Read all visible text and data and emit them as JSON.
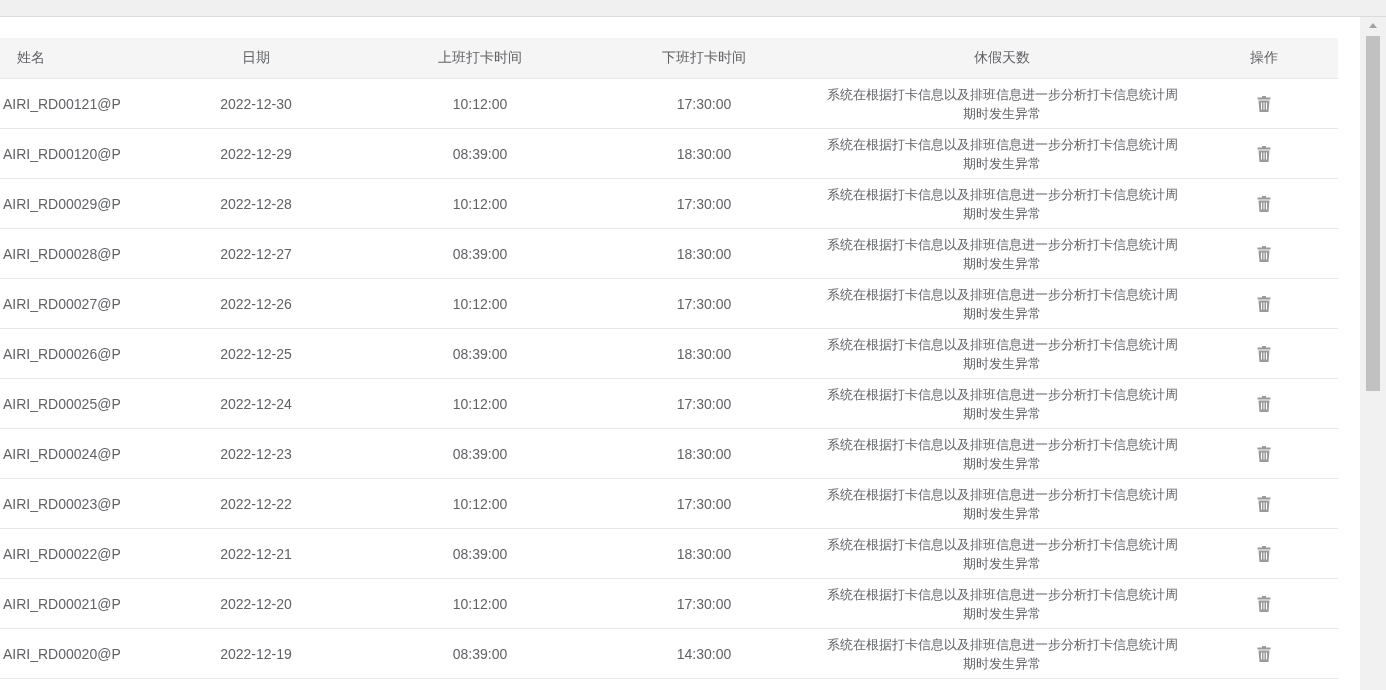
{
  "table": {
    "columns": [
      "姓名",
      "日期",
      "上班打卡时间",
      "下班打卡时间",
      "休假天数",
      "操作"
    ],
    "rows": [
      {
        "name": "AIRI_RD00121@P",
        "date": "2022-12-30",
        "clock_in": "10:12:00",
        "clock_out": "17:30:00",
        "leave_days": "系统在根据打卡信息以及排班信息进一步分析打卡信息统计周期时发生异常"
      },
      {
        "name": "AIRI_RD00120@P",
        "date": "2022-12-29",
        "clock_in": "08:39:00",
        "clock_out": "18:30:00",
        "leave_days": "系统在根据打卡信息以及排班信息进一步分析打卡信息统计周期时发生异常"
      },
      {
        "name": "AIRI_RD00029@P",
        "date": "2022-12-28",
        "clock_in": "10:12:00",
        "clock_out": "17:30:00",
        "leave_days": "系统在根据打卡信息以及排班信息进一步分析打卡信息统计周期时发生异常"
      },
      {
        "name": "AIRI_RD00028@P",
        "date": "2022-12-27",
        "clock_in": "08:39:00",
        "clock_out": "18:30:00",
        "leave_days": "系统在根据打卡信息以及排班信息进一步分析打卡信息统计周期时发生异常"
      },
      {
        "name": "AIRI_RD00027@P",
        "date": "2022-12-26",
        "clock_in": "10:12:00",
        "clock_out": "17:30:00",
        "leave_days": "系统在根据打卡信息以及排班信息进一步分析打卡信息统计周期时发生异常"
      },
      {
        "name": "AIRI_RD00026@P",
        "date": "2022-12-25",
        "clock_in": "08:39:00",
        "clock_out": "18:30:00",
        "leave_days": "系统在根据打卡信息以及排班信息进一步分析打卡信息统计周期时发生异常"
      },
      {
        "name": "AIRI_RD00025@P",
        "date": "2022-12-24",
        "clock_in": "10:12:00",
        "clock_out": "17:30:00",
        "leave_days": "系统在根据打卡信息以及排班信息进一步分析打卡信息统计周期时发生异常"
      },
      {
        "name": "AIRI_RD00024@P",
        "date": "2022-12-23",
        "clock_in": "08:39:00",
        "clock_out": "18:30:00",
        "leave_days": "系统在根据打卡信息以及排班信息进一步分析打卡信息统计周期时发生异常"
      },
      {
        "name": "AIRI_RD00023@P",
        "date": "2022-12-22",
        "clock_in": "10:12:00",
        "clock_out": "17:30:00",
        "leave_days": "系统在根据打卡信息以及排班信息进一步分析打卡信息统计周期时发生异常"
      },
      {
        "name": "AIRI_RD00022@P",
        "date": "2022-12-21",
        "clock_in": "08:39:00",
        "clock_out": "18:30:00",
        "leave_days": "系统在根据打卡信息以及排班信息进一步分析打卡信息统计周期时发生异常"
      },
      {
        "name": "AIRI_RD00021@P",
        "date": "2022-12-20",
        "clock_in": "10:12:00",
        "clock_out": "17:30:00",
        "leave_days": "系统在根据打卡信息以及排班信息进一步分析打卡信息统计周期时发生异常"
      },
      {
        "name": "AIRI_RD00020@P",
        "date": "2022-12-19",
        "clock_in": "08:39:00",
        "clock_out": "14:30:00",
        "leave_days": "系统在根据打卡信息以及排班信息进一步分析打卡信息统计周期时发生异常"
      }
    ]
  }
}
